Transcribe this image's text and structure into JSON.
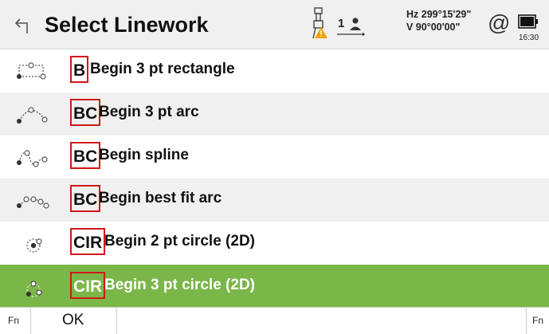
{
  "header": {
    "title": "Select Linework",
    "instrument_icon": "total-station-warning-icon",
    "job_number": "1",
    "person_icon": "person-icon",
    "hz_label": "Hz 299°15'29\"",
    "v_label": "V  90°00'00\"",
    "at_symbol": "@",
    "time": "16:30"
  },
  "items": [
    {
      "code": "B",
      "label": "Begin 3 pt rectangle",
      "icon": "rectangle-3pt-icon",
      "selected": false
    },
    {
      "code": "BC",
      "label": "Begin 3 pt arc",
      "icon": "arc-3pt-icon",
      "selected": false
    },
    {
      "code": "BC",
      "label": "Begin spline",
      "icon": "spline-icon",
      "selected": false
    },
    {
      "code": "BC",
      "label": "Begin best fit arc",
      "icon": "best-fit-arc-icon",
      "selected": false
    },
    {
      "code": "CIR",
      "label": "Begin 2 pt circle (2D)",
      "icon": "circle-2pt-icon",
      "selected": false
    },
    {
      "code": "CIR",
      "label": "Begin 3 pt circle (2D)",
      "icon": "circle-3pt-icon",
      "selected": true
    }
  ],
  "footer": {
    "fn_left": "Fn",
    "ok": "OK",
    "fn_right": "Fn"
  },
  "colors": {
    "selected_row": "#7ab648",
    "highlight_box": "#d01818",
    "alt_row": "#f0f0f0"
  }
}
